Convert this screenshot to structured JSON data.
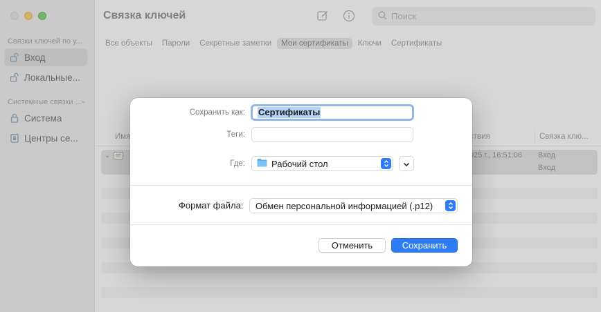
{
  "window": {
    "title": "Связка ключей"
  },
  "sidebar": {
    "header1": "Связки ключей по у...",
    "header2": "Системные связки ...",
    "items": [
      {
        "label": "Вход",
        "icon": "lock-open-icon"
      },
      {
        "label": "Локальные...",
        "icon": "lock-open-icon"
      },
      {
        "label": "Система",
        "icon": "lock-icon"
      },
      {
        "label": "Центры се...",
        "icon": "lock-cabinet-icon"
      }
    ]
  },
  "toolbar": {
    "search_placeholder": "Поиск"
  },
  "tabs": [
    "Все объекты",
    "Пароли",
    "Секретные заметки",
    "Мои сертификаты",
    "Ключи",
    "Сертификаты"
  ],
  "active_tab": "Мои сертификаты",
  "table": {
    "columns": {
      "name": "Имя",
      "expires": "ствия",
      "keychain": "Связка клю..."
    },
    "rows": [
      {
        "expires": "025 г., 16:51:06",
        "keychain": "Вход"
      },
      {
        "expires": "",
        "keychain": "Вход"
      }
    ]
  },
  "dialog": {
    "save_as_label": "Сохранить как:",
    "save_as_value": "Сертификаты",
    "tags_label": "Теги:",
    "where_label": "Где:",
    "where_value": "Рабочий стол",
    "format_label": "Формат файла:",
    "format_value": "Обмен персональной информацией (.p12)",
    "cancel_label": "Отменить",
    "save_label": "Сохранить"
  },
  "colors": {
    "accent": "#2d7cf6",
    "selection": "#b5d3f5"
  }
}
